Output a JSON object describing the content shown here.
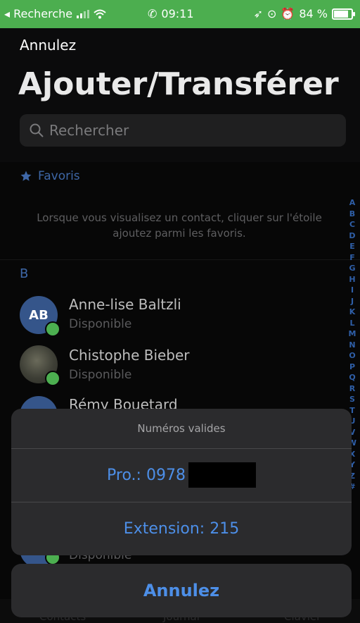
{
  "status_bar": {
    "back_app": "◂ Recherche",
    "time": "09:11",
    "battery": "84 %",
    "battery_level": 0.84
  },
  "header": {
    "cancel": "Annulez",
    "title": "Ajouter/Transférer u…",
    "search_placeholder": "Rechercher"
  },
  "favorites": {
    "label": "Favoris",
    "info": "Lorsque vous visualisez un contact, cliquer sur l'étoile ajoutez parmi les favoris."
  },
  "section_letter": "B",
  "contacts": [
    {
      "initials": "AB",
      "name": "Anne-lise Baltzli",
      "status": "Disponible"
    },
    {
      "initials": "",
      "name": "Chistophe Bieber",
      "status": "Disponible"
    },
    {
      "initials": "",
      "name": "Rémy Bouetard",
      "status": ""
    },
    {
      "initials": "",
      "name": "",
      "status": "Disponible"
    }
  ],
  "alphabet": [
    "A",
    "B",
    "C",
    "D",
    "E",
    "F",
    "G",
    "H",
    "I",
    "J",
    "K",
    "L",
    "M",
    "N",
    "O",
    "P",
    "Q",
    "R",
    "S",
    "T",
    "U",
    "V",
    "W",
    "X",
    "Y",
    "Z",
    "#"
  ],
  "action_sheet": {
    "title": "Numéros valides",
    "option_pro": "Pro.: 0978",
    "option_extension": "Extension: 215",
    "cancel": "Annulez"
  },
  "tabs": [
    "Contacts",
    "Journal",
    "Clavier"
  ],
  "colors": {
    "status_bar": "#4cae4f",
    "accent": "#4d8fe8",
    "available": "#4caf50"
  }
}
